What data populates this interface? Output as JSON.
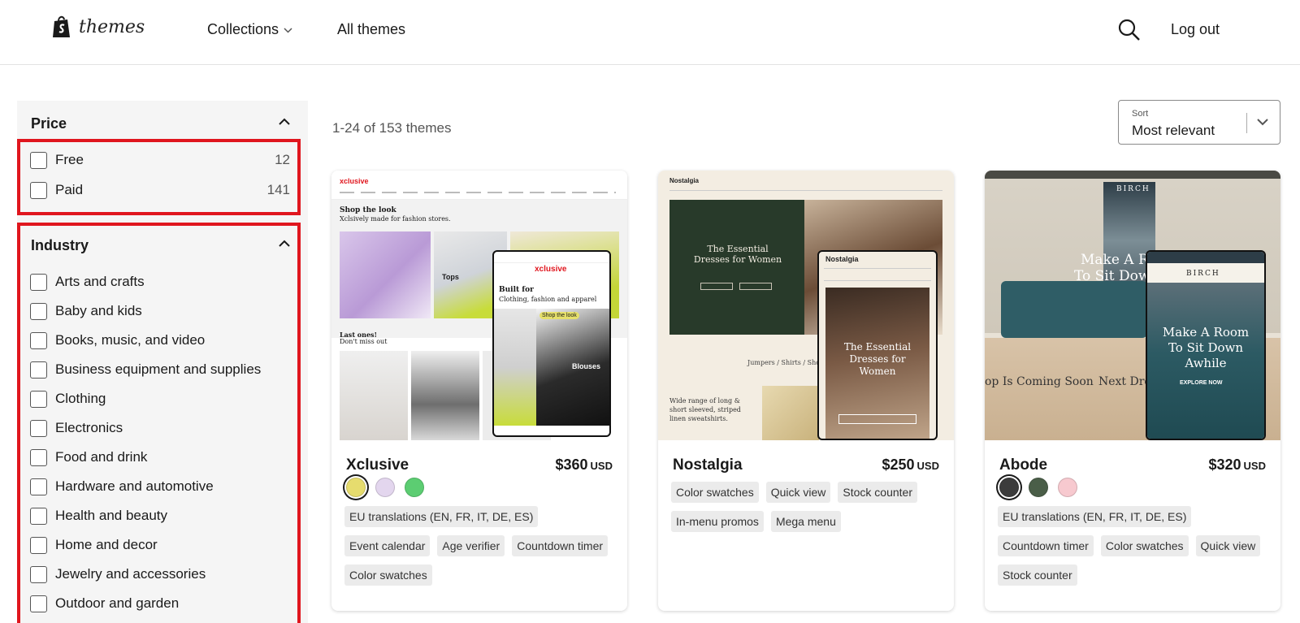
{
  "header": {
    "logo_text": "themes",
    "nav": {
      "collections": "Collections",
      "all_themes": "All themes"
    },
    "logout": "Log out"
  },
  "filters": {
    "price": {
      "title": "Price",
      "options": [
        {
          "label": "Free",
          "count": "12"
        },
        {
          "label": "Paid",
          "count": "141"
        }
      ]
    },
    "industry": {
      "title": "Industry",
      "options": [
        "Arts and crafts",
        "Baby and kids",
        "Books, music, and video",
        "Business equipment and supplies",
        "Clothing",
        "Electronics",
        "Food and drink",
        "Hardware and automotive",
        "Health and beauty",
        "Home and decor",
        "Jewelry and accessories",
        "Outdoor and garden"
      ]
    }
  },
  "results": {
    "count_text": "1-24 of 153 themes"
  },
  "sort": {
    "caption": "Sort",
    "value": "Most relevant"
  },
  "themes": [
    {
      "name": "Xclusive",
      "price": "$360",
      "currency": "USD",
      "swatches": [
        "#e6dc6e",
        "#e3d6ee",
        "#5ccd72"
      ],
      "tags": [
        "EU translations (EN, FR, IT, DE, ES)",
        "Event calendar",
        "Age verifier",
        "Countdown timer",
        "Color swatches"
      ],
      "thumb": {
        "brand": "xclusive",
        "hero_title": "Shop the look",
        "hero_sub": "Xclsively made for fashion stores.",
        "tops_label": "Tops",
        "phone_title": "Built for",
        "phone_sub": "Clothing, fashion and apparel",
        "phone_btn": "Shop the look",
        "blouses": "Blouses",
        "last_title": "Last ones!",
        "last_sub": "Don't miss out"
      }
    },
    {
      "name": "Nostalgia",
      "price": "$250",
      "currency": "USD",
      "swatches": [],
      "tags": [
        "Color swatches",
        "Quick view",
        "Stock counter",
        "In-menu promos",
        "Mega menu"
      ],
      "thumb": {
        "brand": "Nostalgia",
        "hero_title": "The Essential Dresses for Women",
        "phone_title": "The Essential Dresses for Women",
        "crumbs": "Jumpers  /  Shirts  /  Shorts & S",
        "side_text": "Wide range of long & short sleeved, striped linen sweatshirts."
      }
    },
    {
      "name": "Abode",
      "price": "$320",
      "currency": "USD",
      "swatches": [
        "#3c3c3c",
        "#4a5e48",
        "#f7c9cf"
      ],
      "tags": [
        "EU translations (EN, FR, IT, DE, ES)",
        "Countdown timer",
        "Color swatches",
        "Quick view",
        "Stock counter"
      ],
      "thumb": {
        "brand": "BIRCH",
        "hero_title": "Make A R",
        "hero_title2": "To Sit Down",
        "phone_title": "Make A Room To Sit Down Awhile",
        "phone_btn": "EXPLORE NOW",
        "ticker_left": "op Is Coming Soon",
        "ticker_right": "Next Drop"
      }
    }
  ],
  "colors": {
    "highlight": "#e0161e",
    "sidebar_bg": "#f5f5f5",
    "tag_bg": "#ebebeb"
  }
}
